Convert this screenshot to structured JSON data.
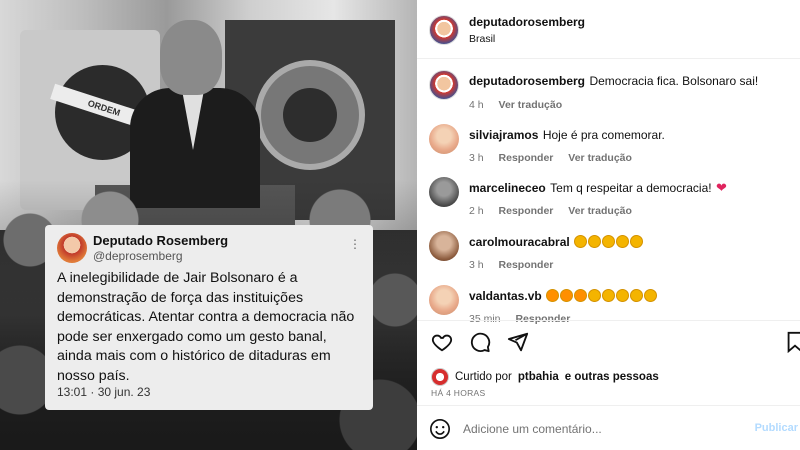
{
  "photo": {
    "flag_band_text": "ORDEM",
    "tweet": {
      "name": "Deputado Rosemberg",
      "handle": "@deprosemberg",
      "text": "A inelegibilidade de Jair Bolsonaro é a demonstração de força das instituições democráticas. Atentar contra a democracia não pode ser enxergado como um gesto banal, ainda mais com o histórico de ditaduras em nosso país.",
      "timestamp": "13:01 · 30 jun. 23",
      "more_icon": "more-vertical-icon"
    }
  },
  "post": {
    "username": "deputadorosemberg",
    "location": "Brasil",
    "caption": {
      "username": "deputadorosemberg",
      "text": "Democracia fica. Bolsonaro sai!",
      "time": "4 h",
      "translate": "Ver tradução"
    },
    "comments": [
      {
        "username": "silviajramos",
        "text": "Hoje é pra comemorar.",
        "time": "3 h",
        "reply": "Responder",
        "translate": "Ver tradução"
      },
      {
        "username": "marcelineceo",
        "text": "Tem q respeitar a democracia!",
        "time": "2 h",
        "reply": "Responder",
        "translate": "Ver tradução"
      },
      {
        "username": "carolmouracabral",
        "text": "",
        "time": "3 h",
        "reply": "Responder"
      },
      {
        "username": "valdantas.vb",
        "text": "",
        "time": "35 min",
        "reply": "Responder"
      }
    ],
    "liked_by_prefix": "Curtido por",
    "liked_by_user": "ptbahia",
    "liked_by_suffix": "e outras pessoas",
    "time_ago": "HÁ 4 HORAS",
    "comment_placeholder": "Adicione um comentário...",
    "publish_label": "Publicar"
  },
  "colors": {
    "link_blue": "#b3dbff",
    "heart_red": "#e0245e"
  }
}
